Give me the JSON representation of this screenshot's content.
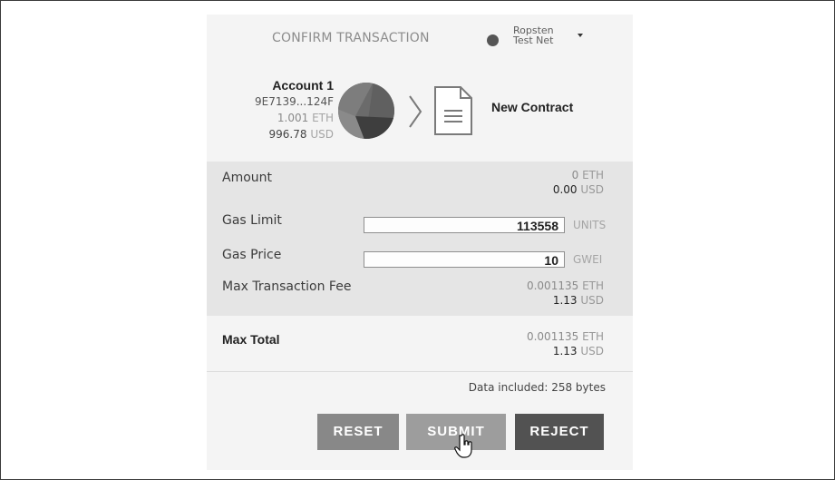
{
  "header": {
    "title": "CONFIRM TRANSACTION",
    "network": {
      "name_line1": "Ropsten",
      "name_line2": "Test Net"
    },
    "colors": {
      "network_dot": "#555555"
    }
  },
  "sender": {
    "name": "Account 1",
    "address": "9E7139...124F",
    "eth_amount": "1.001",
    "eth_unit": "ETH",
    "usd_amount": "996.78",
    "usd_unit": "USD",
    "icon": "identicon"
  },
  "recipient": {
    "icon": "document-icon",
    "label": "New Contract"
  },
  "details": {
    "amount": {
      "label": "Amount",
      "eth_value": "0",
      "eth_unit": "ETH",
      "usd_value": "0.00",
      "usd_unit": "USD"
    },
    "gas_limit": {
      "label": "Gas Limit",
      "value": "113558",
      "unit": "UNITS"
    },
    "gas_price": {
      "label": "Gas Price",
      "value": "10",
      "unit": "GWEI"
    },
    "max_fee": {
      "label": "Max Transaction Fee",
      "eth_value": "0.001135",
      "eth_unit": "ETH",
      "usd_value": "1.13",
      "usd_unit": "USD"
    }
  },
  "total": {
    "label": "Max Total",
    "eth_value": "0.001135",
    "eth_unit": "ETH",
    "usd_value": "1.13",
    "usd_unit": "USD"
  },
  "data_included": "Data included: 258 bytes",
  "buttons": {
    "reset": "RESET",
    "submit": "SUBMIT",
    "reject": "REJECT"
  }
}
